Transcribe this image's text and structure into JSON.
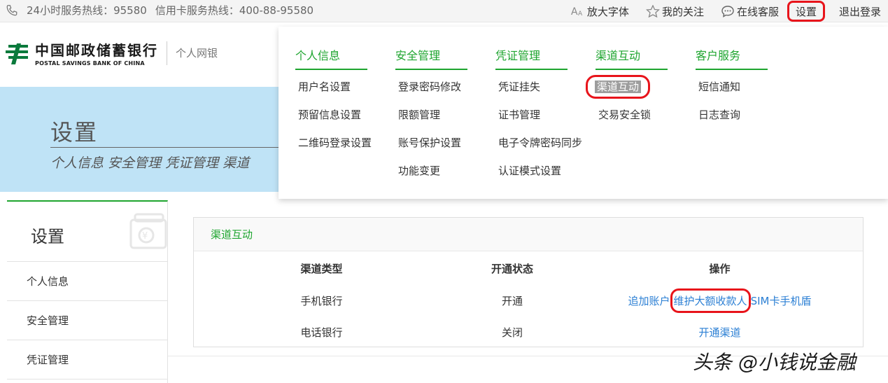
{
  "topbar": {
    "hotline_text": "24小时服务热线：95580",
    "card_hotline_text": "信用卡服务热线：400-88-95580",
    "links": {
      "font_size": "放大字体",
      "my_follow": "我的关注",
      "online_service": "在线客服",
      "settings": "设置",
      "logout": "退出登录"
    }
  },
  "header": {
    "logo_cn": "中国邮政储蓄银行",
    "logo_en": "POSTAL SAVINGS BANK OF CHINA",
    "logo_sub": "个人网银"
  },
  "banner": {
    "title": "设置",
    "subtitle": "个人信息 安全管理 凭证管理 渠道"
  },
  "mega_menu": {
    "columns": [
      {
        "heading": "个人信息",
        "items": [
          "用户名设置",
          "预留信息设置",
          "二维码登录设置"
        ]
      },
      {
        "heading": "安全管理",
        "items": [
          "登录密码修改",
          "限额管理",
          "账号保护设置",
          "功能变更"
        ]
      },
      {
        "heading": "凭证管理",
        "items": [
          "凭证挂失",
          "证书管理",
          "电子令牌密码同步",
          "认证模式设置"
        ]
      },
      {
        "heading": "渠道互动",
        "items": [
          "渠道互动",
          "交易安全锁"
        ]
      },
      {
        "heading": "客户服务",
        "items": [
          "短信通知",
          "日志查询"
        ]
      }
    ]
  },
  "sidebar": {
    "title": "设置",
    "items": [
      "个人信息",
      "安全管理",
      "凭证管理"
    ]
  },
  "content": {
    "section_title": "渠道互动",
    "headers": [
      "渠道类型",
      "开通状态",
      "操作"
    ],
    "rows": [
      {
        "type": "手机银行",
        "status": "开通",
        "ops": [
          "追加账户",
          "维护大额收款人",
          "SIM卡手机盾"
        ]
      },
      {
        "type": "电话银行",
        "status": "关闭",
        "ops": [
          "开通渠道"
        ]
      }
    ]
  },
  "watermark": "头条 @小钱说金融",
  "colors": {
    "accent_green": "#1ea52f",
    "link_blue": "#2b7fd4",
    "highlight_red": "#e8141b",
    "banner_blue": "#bfe3f6"
  },
  "icons": [
    "phone-icon",
    "font-size-icon",
    "star-icon",
    "chat-bubble-icon",
    "psbc-logo-icon",
    "wallet-icon"
  ]
}
